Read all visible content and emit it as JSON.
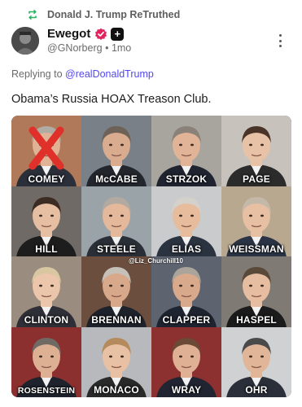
{
  "retruth": {
    "icon": "retruth-icon",
    "text": "Donald J. Trump ReTruthed",
    "color": "#2db35d"
  },
  "author": {
    "name": "Ewegot",
    "handle": "@GNorberg",
    "separator": "•",
    "time": "1mo",
    "verified_color": "#e0245e",
    "plus_label": "+"
  },
  "reply": {
    "prefix": "Replying to",
    "target": "@realDonaldTrump",
    "link_color": "#5448ee"
  },
  "post": {
    "text": "Obama’s Russia HOAX Treason Club."
  },
  "image": {
    "watermark": "@Liz_Churchill10",
    "cells": [
      {
        "label": "COMEY",
        "bg": "#b07a5a",
        "skin": "#e0b396",
        "hair": "#b0aba3",
        "suit": "#2b2f3a",
        "crossed": true
      },
      {
        "label": "McCABE",
        "bg": "#7a8088",
        "skin": "#d9ab8f",
        "hair": "#6d6158",
        "suit": "#23262d",
        "crossed": false
      },
      {
        "label": "STRZOK",
        "bg": "#a8a59e",
        "skin": "#e2b497",
        "hair": "#8a8279",
        "suit": "#1f2430",
        "crossed": false
      },
      {
        "label": "PAGE",
        "bg": "#c7c2bc",
        "skin": "#e8c2a6",
        "hair": "#4a3428",
        "suit": "#2b2b2b",
        "crossed": false
      },
      {
        "label": "HILL",
        "bg": "#6f6a66",
        "skin": "#e6bfa3",
        "hair": "#3c2b22",
        "suit": "#1d1d1d",
        "crossed": false
      },
      {
        "label": "STEELE",
        "bg": "#9aa3a8",
        "skin": "#e4b89b",
        "hair": "#b2aaa1",
        "suit": "#2a2e36",
        "crossed": false
      },
      {
        "label": "ELIAS",
        "bg": "#c9cbcc",
        "skin": "#e6bc9c",
        "hair": "#d4d0ca",
        "suit": "#2b3340",
        "crossed": false
      },
      {
        "label": "WEISSMAN",
        "bg": "#b8a88f",
        "skin": "#e7c0a4",
        "hair": "#c4b8a8",
        "suit": "#2a3444",
        "crossed": false
      },
      {
        "label": "CLINTON",
        "bg": "#9a8d7f",
        "skin": "#ecc6aa",
        "hair": "#d8c7a0",
        "suit": "#2f2f38",
        "crossed": false
      },
      {
        "label": "BRENNAN",
        "bg": "#6b4e3e",
        "skin": "#d8a88b",
        "hair": "#c5c0b8",
        "suit": "#1e222a",
        "crossed": false
      },
      {
        "label": "CLAPPER",
        "bg": "#5d6470",
        "skin": "#d9a98c",
        "hair": "#aaa49a",
        "suit": "#1f2530",
        "crossed": false
      },
      {
        "label": "HASPEL",
        "bg": "#807a74",
        "skin": "#e6bda0",
        "hair": "#5a4838",
        "suit": "#1b1b1b",
        "crossed": false
      },
      {
        "label": "ROSENSTEIN",
        "bg": "#8c2f2f",
        "skin": "#deb093",
        "hair": "#6f6a64",
        "suit": "#1e232d",
        "crossed": false
      },
      {
        "label": "MONACO",
        "bg": "#b7b9bd",
        "skin": "#e8c0a3",
        "hair": "#b58a5c",
        "suit": "#2a2a2a",
        "crossed": false
      },
      {
        "label": "WRAY",
        "bg": "#8c3030",
        "skin": "#e0b094",
        "hair": "#6a4a36",
        "suit": "#202531",
        "crossed": false
      },
      {
        "label": "OHR",
        "bg": "#d0d1d3",
        "skin": "#e1b597",
        "hair": "#4a4a4a",
        "suit": "#2a2f3a",
        "crossed": false
      }
    ]
  },
  "icons": {
    "more": "more-vertical-icon",
    "verified": "verified-badge-icon",
    "plus": "truth-plus-icon"
  }
}
